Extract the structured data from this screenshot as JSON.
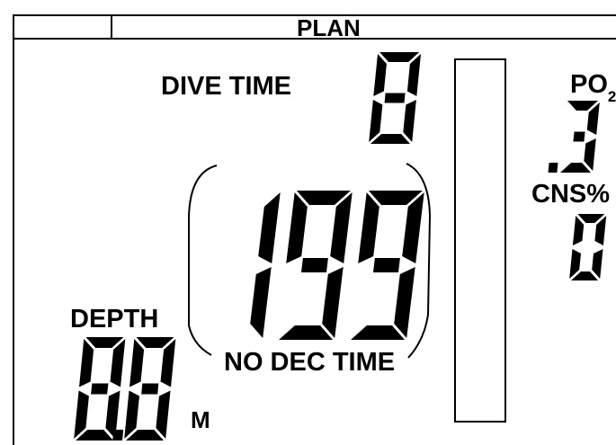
{
  "header": {
    "mode_label": "PLAN"
  },
  "dive_time": {
    "label": "DIVE TIME",
    "value": "8"
  },
  "no_dec_time": {
    "label": "NO DEC TIME",
    "value": "199"
  },
  "depth": {
    "label": "DEPTH",
    "value": "8.8",
    "unit": "M"
  },
  "po2": {
    "label": "PO",
    "subscript": "2",
    "value": ".3"
  },
  "cns": {
    "label": "CNS%",
    "value": "0"
  }
}
